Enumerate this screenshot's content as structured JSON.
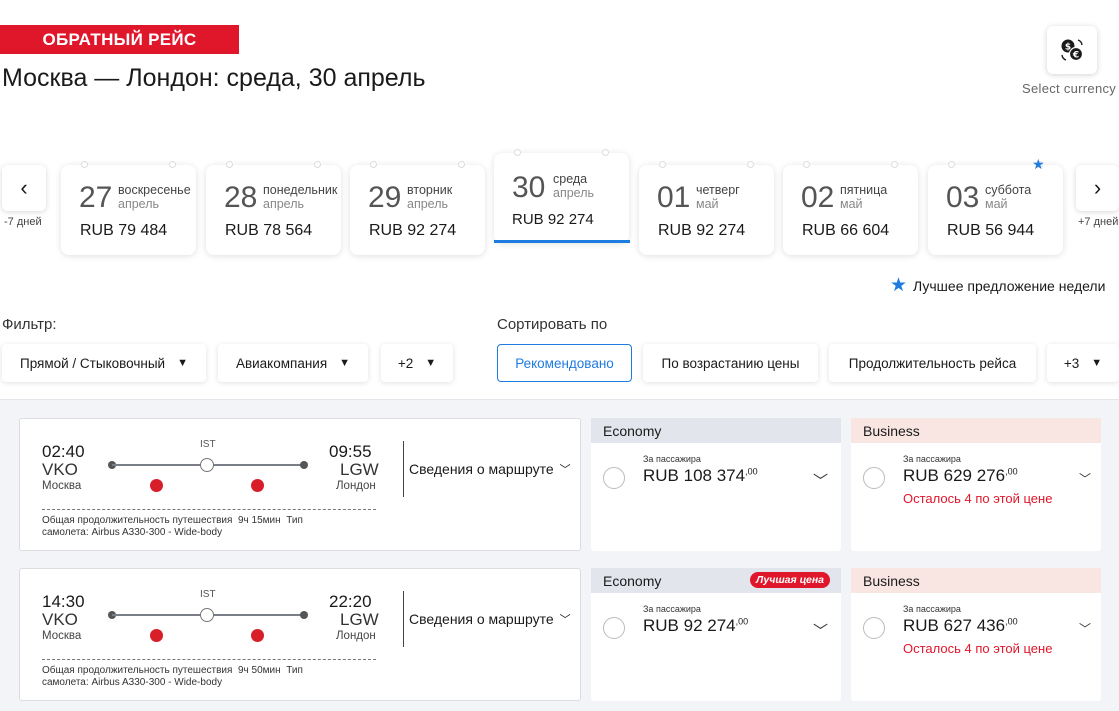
{
  "header": {
    "badge": "ОБРАТНЫЙ РЕЙС",
    "route_title": "Москва — Лондон: среда, 30 апрель",
    "currency_label": "Select currency",
    "currency_icon": "currency-exchange-icon"
  },
  "date_strip": {
    "prev_label": "-7 дней",
    "next_label": "+7 дней",
    "best_week_label": "Лучшее предложение недели",
    "dates": [
      {
        "num": "27",
        "day": "воскресенье",
        "month": "апрель",
        "price": "RUB 79 484"
      },
      {
        "num": "28",
        "day": "понедельник",
        "month": "апрель",
        "price": "RUB 78 564"
      },
      {
        "num": "29",
        "day": "вторник",
        "month": "апрель",
        "price": "RUB 92 274"
      },
      {
        "num": "30",
        "day": "среда",
        "month": "апрель",
        "price": "RUB 92 274",
        "selected": true
      },
      {
        "num": "01",
        "day": "четверг",
        "month": "май",
        "price": "RUB 92 274"
      },
      {
        "num": "02",
        "day": "пятница",
        "month": "май",
        "price": "RUB 66 604"
      },
      {
        "num": "03",
        "day": "суббота",
        "month": "май",
        "price": "RUB 56 944",
        "best_of_week": true
      }
    ]
  },
  "filters": {
    "label": "Фильтр:",
    "items": [
      "Прямой / Стыковочный",
      "Авиакомпания",
      "+2"
    ]
  },
  "sort": {
    "label": "Сортировать по",
    "items": [
      "Рекомендовано",
      "По возрастанию цены",
      "Продолжительность рейса",
      "+3"
    ],
    "selected": "Рекомендовано"
  },
  "flights": [
    {
      "dep_time": "02:40",
      "dep_code": "VKO",
      "dep_city": "Москва",
      "arr_time": "09:55",
      "arr_code": "LGW",
      "arr_city": "Лондон",
      "stop": "IST",
      "details_label": "Сведения о маршруте",
      "duration_label": "Общая продолжительность путешествия",
      "duration": "9ч 15мин",
      "aircraft_label": "Тип самолета:",
      "aircraft": "Airbus A330-300 - Wide-body",
      "economy": {
        "title": "Economy",
        "per": "За пассажира",
        "price": "RUB 108 374",
        "cents": ",00",
        "best_price": ""
      },
      "business": {
        "title": "Business",
        "per": "За пассажира",
        "price": "RUB 629 276",
        "cents": ",00",
        "note": "Осталось 4 по этой цене"
      }
    },
    {
      "dep_time": "14:30",
      "dep_code": "VKO",
      "dep_city": "Москва",
      "arr_time": "22:20",
      "arr_code": "LGW",
      "arr_city": "Лондон",
      "stop": "IST",
      "details_label": "Сведения о маршруте",
      "duration_label": "Общая продолжительность путешествия",
      "duration": "9ч 50мин",
      "aircraft_label": "Тип самолета:",
      "aircraft": "Airbus A330-300 - Wide-body",
      "economy": {
        "title": "Economy",
        "per": "За пассажира",
        "price": "RUB 92 274",
        "cents": ",00",
        "best_price": "Лучшая цена"
      },
      "business": {
        "title": "Business",
        "per": "За пассажира",
        "price": "RUB 627 436",
        "cents": ",00",
        "note": "Осталось 4 по этой цене"
      }
    }
  ],
  "colors": {
    "brand_red": "#e0162b",
    "accent_blue": "#1e7be0"
  }
}
